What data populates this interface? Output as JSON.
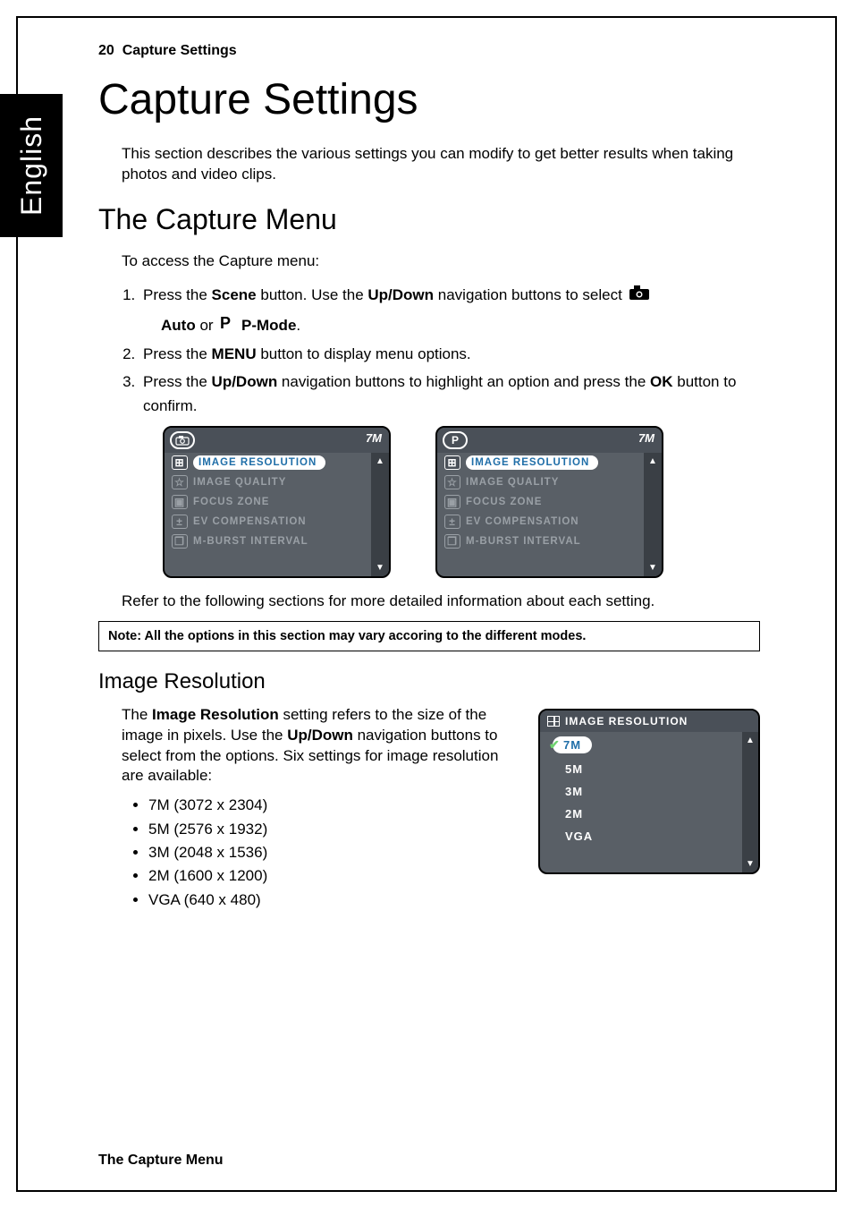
{
  "language_tab": "English",
  "header": {
    "page_number": "20",
    "section": "Capture Settings"
  },
  "chapter_title": "Capture Settings",
  "intro": "This section describes the various settings you can modify to get better results when taking photos and video clips.",
  "section_title": "The Capture Menu",
  "access_line": "To access the Capture menu:",
  "steps": {
    "s1_a": "Press the ",
    "s1_scene": "Scene",
    "s1_b": " button. Use the ",
    "s1_updown": "Up/Down",
    "s1_c": " navigation buttons to select ",
    "s1_auto": "Auto",
    "s1_or": " or ",
    "s1_pmode": "P-Mode",
    "s1_end": ".",
    "s2_a": "Press the ",
    "s2_menu": "MENU",
    "s2_b": " button to display menu options.",
    "s3_a": "Press the ",
    "s3_updown": "Up/Down",
    "s3_b": " navigation buttons to highlight an option and press the ",
    "s3_ok": "OK",
    "s3_c": " button to confirm."
  },
  "cam_menu_items": [
    {
      "label": "IMAGE RESOLUTION",
      "icon": "⊞"
    },
    {
      "label": "IMAGE QUALITY",
      "icon": "☆"
    },
    {
      "label": "FOCUS ZONE",
      "icon": "▣"
    },
    {
      "label": "EV COMPENSATION",
      "icon": "±"
    },
    {
      "label": "M-BURST INTERVAL",
      "icon": "❐"
    }
  ],
  "cam_badge": "7M",
  "refer_line": "Refer to the following sections for more detailed information about each setting.",
  "note_text": "Note: All the options in this section may vary accoring to the different modes.",
  "sub_title": "Image Resolution",
  "res_para": {
    "a": "The ",
    "b": "Image Resolution",
    "c": " setting refers to the size of the image in pixels. Use the ",
    "d": "Up/Down",
    "e": " navigation buttons to select from the options. Six settings for image resolution are available:"
  },
  "res_list": [
    "7M (3072 x 2304)",
    "5M (2576 x 1932)",
    "3M (2048 x 1536)",
    "2M (1600 x 1200)",
    "VGA (640 x 480)"
  ],
  "res_screen": {
    "title": "IMAGE RESOLUTION",
    "items": [
      "7M",
      "5M",
      "3M",
      "2M",
      "VGA"
    ],
    "selected": "7M"
  },
  "footer": "The Capture Menu",
  "arrows": {
    "up": "▲",
    "down": "▼"
  }
}
